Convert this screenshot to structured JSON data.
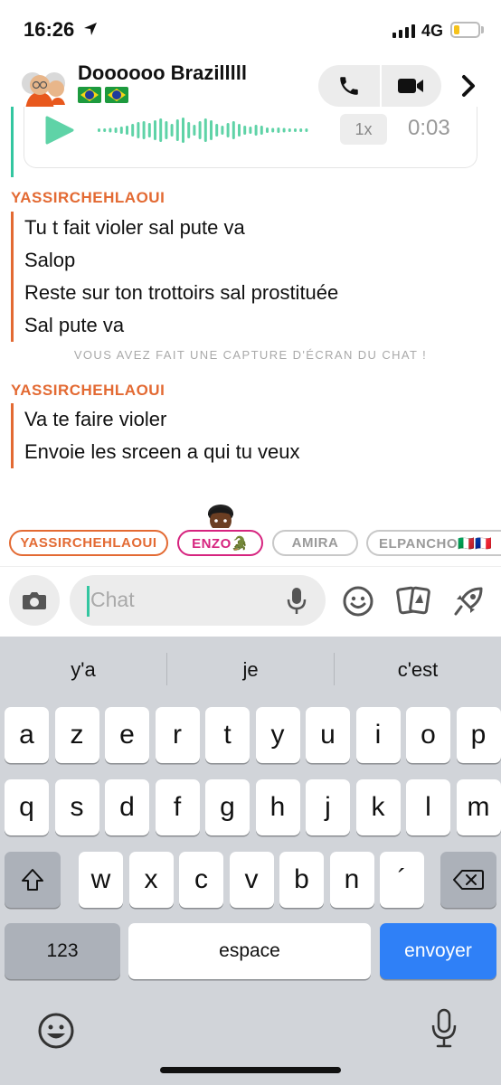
{
  "status_bar": {
    "time": "16:26",
    "network": "4G",
    "battery_level": 0.25,
    "signal_bars": 4
  },
  "header": {
    "title": "Doooooo Brazilllll",
    "flag_icons": [
      "brazil-flag-icon",
      "brazil-flag-icon"
    ],
    "call_icon": "phone-icon",
    "video_icon": "video-camera-icon"
  },
  "audio_message": {
    "speed": "1x",
    "duration": "0:03"
  },
  "messages": [
    {
      "sender": "YASSIRCHEHLAOUI",
      "lines": [
        "Tu t fait violer sal pute va",
        "Salop",
        "Reste sur ton trottoirs sal prostituée",
        "Sal pute va"
      ]
    },
    {
      "sender": "YASSIRCHEHLAOUI",
      "lines": [
        "Va te faire violer",
        "Envoie les srceen a qui tu veux"
      ]
    }
  ],
  "system_note": "VOUS AVEZ FAIT UNE CAPTURE D'ÉCRAN DU CHAT !",
  "participants": [
    {
      "name": "YASSIRCHEHLAOUI",
      "color": "#e36a33"
    },
    {
      "name": "ENZO🐊",
      "color": "#d6247f"
    },
    {
      "name": "AMIRA",
      "color": "#9a9a9a"
    },
    {
      "name": "ELPANCHO🇮🇹🇫🇷",
      "color": "#9a9a9a"
    }
  ],
  "input": {
    "placeholder": "Chat"
  },
  "keyboard": {
    "suggestions": [
      "y'a",
      "je",
      "c'est"
    ],
    "row1": [
      "a",
      "z",
      "e",
      "r",
      "t",
      "y",
      "u",
      "i",
      "o",
      "p"
    ],
    "row2": [
      "q",
      "s",
      "d",
      "f",
      "g",
      "h",
      "j",
      "k",
      "l",
      "m"
    ],
    "row3": [
      "w",
      "x",
      "c",
      "v",
      "b",
      "n",
      "´"
    ],
    "numbers_key": "123",
    "space_key": "espace",
    "return_key": "envoyer"
  },
  "colors": {
    "accent_orange": "#e36a33",
    "teal": "#33c6a0",
    "return_blue": "#2f80f7"
  }
}
